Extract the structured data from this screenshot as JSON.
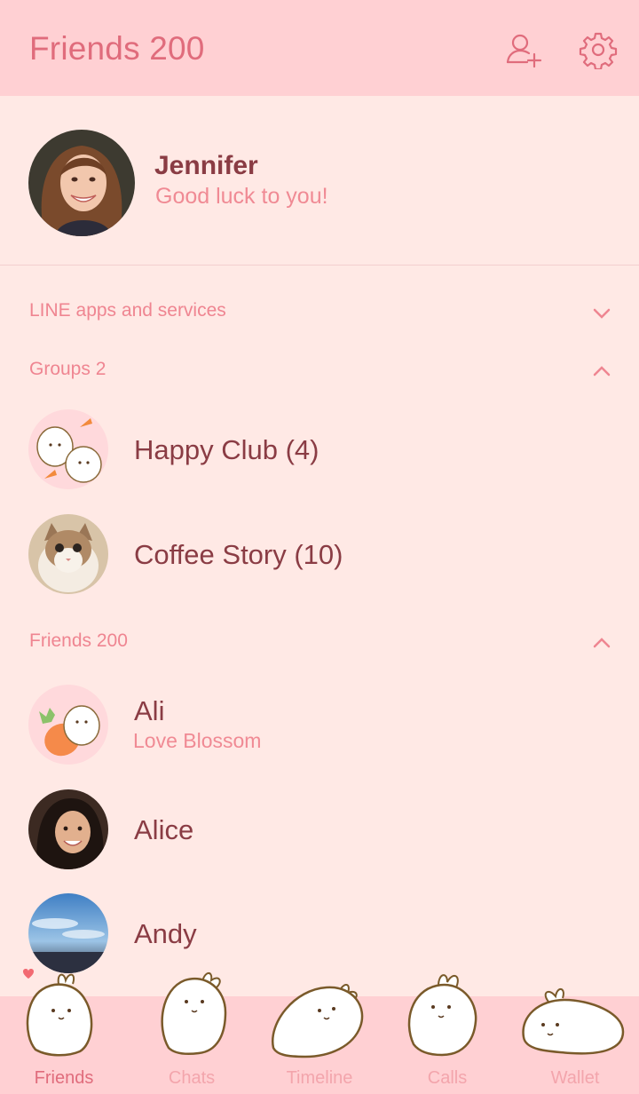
{
  "header": {
    "title": "Friends 200"
  },
  "profile": {
    "name": "Jennifer",
    "status": "Good luck to you!"
  },
  "sections": {
    "services": "LINE apps and services",
    "groups": "Groups 2",
    "friends": "Friends 200"
  },
  "groups": [
    {
      "name": "Happy Club (4)",
      "avatar": "bunny-carrot-avatar"
    },
    {
      "name": "Coffee Story (10)",
      "avatar": "cat-avatar"
    }
  ],
  "friends": [
    {
      "name": "Ali",
      "status": "Love Blossom",
      "avatar": "bunny-carrot-avatar"
    },
    {
      "name": "Alice",
      "status": "",
      "avatar": "person-avatar"
    },
    {
      "name": "Andy",
      "status": "",
      "avatar": "sky-avatar"
    }
  ],
  "tabs": [
    {
      "label": "Friends",
      "active": true
    },
    {
      "label": "Chats",
      "active": false
    },
    {
      "label": "Timeline",
      "active": false
    },
    {
      "label": "Calls",
      "active": false
    },
    {
      "label": "Wallet",
      "active": false
    }
  ],
  "colors": {
    "header_bg": "#ffd0d3",
    "body_bg": "#ffe9e5",
    "accent": "#e06c7c",
    "text_dark": "#8a3c44"
  }
}
